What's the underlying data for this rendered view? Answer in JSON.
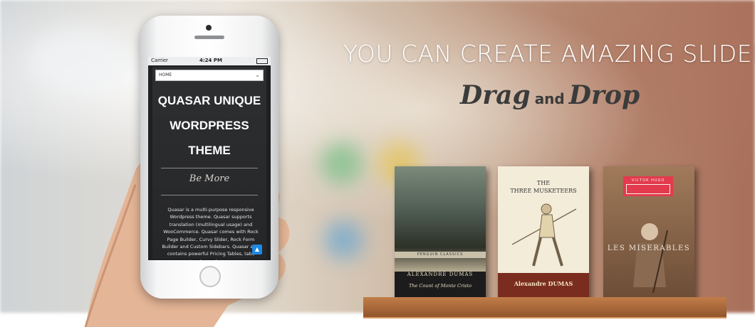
{
  "headline": "YOU CAN CREATE AMAZING SLIDERS",
  "subline": {
    "drag": "Drag",
    "and": "and",
    "drop": "Drop"
  },
  "phone": {
    "carrier": "Carrier",
    "time": "4:24 PM",
    "menu_value": "HOME",
    "site_title_lines": [
      "QUASAR UNIQUE",
      "WORDPRESS",
      "THEME"
    ],
    "tagline": "Be More",
    "description": "Quasar is a multi-purpose responsive Wordpress theme. Quasar supports translation (multilingual usage) and WooCommerce. Quasar comes with Rock Page Builder, Curvy Slider, Rock Form Builder and Custom Sidebars. Quasar also contains powerful Pricing Tables, tabs toggles and more."
  },
  "books": [
    {
      "series": "PENGUIN CLASSICS",
      "author": "ALEXANDRE DUMAS",
      "title": "The Count of Monte Cristo"
    },
    {
      "title_line1": "THE",
      "title_line2": "THREE MUSKETEERS",
      "author": "Alexandre DUMAS"
    },
    {
      "label": "VICTOR HUGO",
      "title": "LES MISERABLES"
    }
  ]
}
